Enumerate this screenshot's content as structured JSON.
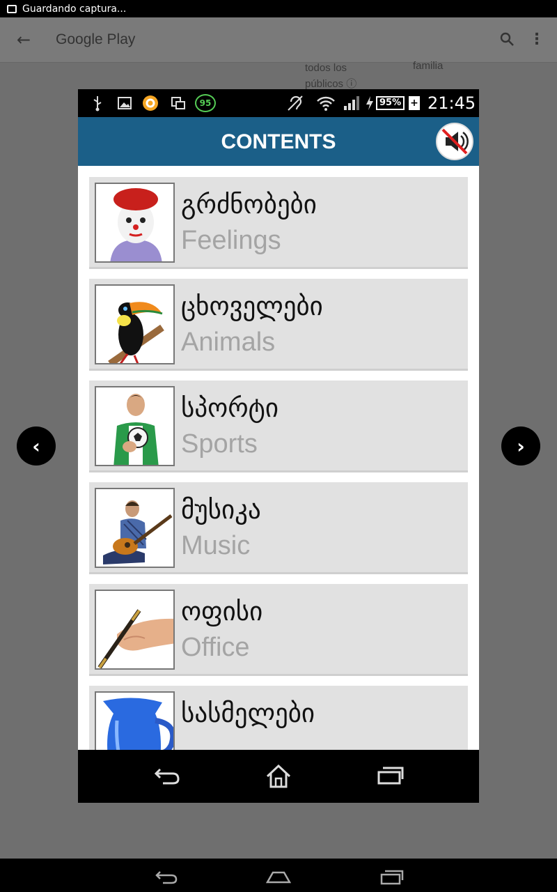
{
  "outer_status": {
    "text": "Guardando captura..."
  },
  "gp_header": {
    "back_glyph": "←",
    "title": "Google Play",
    "search_glyph": "⌕",
    "more_glyph": "⋮",
    "bg_text_1_line1": "todos los",
    "bg_text_1_line2": "públicos ⓘ",
    "bg_text_2": "familia"
  },
  "side_nav": {
    "prev_glyph": "‹",
    "next_glyph": "›"
  },
  "phone_status": {
    "notification": "95",
    "battery": "95%",
    "plus": "+",
    "time": "21:45"
  },
  "phone_header": {
    "title": "CONTENTS",
    "mute_icon": "speaker-muted-icon"
  },
  "items": [
    {
      "geo": "გრძნობები",
      "eng": "Feelings",
      "image": "clown-image"
    },
    {
      "geo": "ცხოველები",
      "eng": "Animals",
      "image": "toucan-image"
    },
    {
      "geo": "სპორტი",
      "eng": "Sports",
      "image": "soccer-player-image"
    },
    {
      "geo": "მუსიკა",
      "eng": "Music",
      "image": "guitarist-image"
    },
    {
      "geo": "ოფისი",
      "eng": "Office",
      "image": "pen-hand-image"
    },
    {
      "geo": "სასმელები",
      "eng": "",
      "image": "blue-jug-image"
    }
  ],
  "colors": {
    "header_blue": "#1b5f88",
    "item_bg": "#e1e1e1",
    "eng_gray": "#a4a4a4"
  }
}
